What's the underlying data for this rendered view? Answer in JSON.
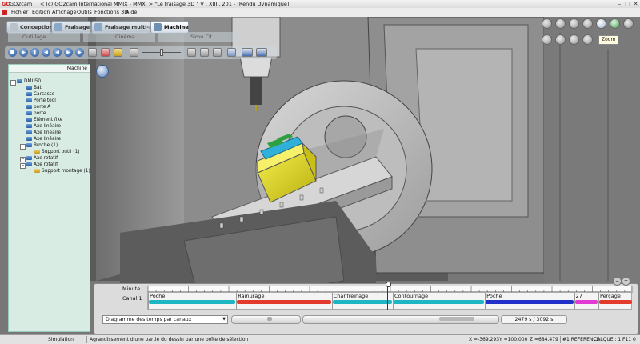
{
  "titlebar": {
    "app": "GO2cam",
    "title": "< (c) GO2cam International MMIX - MMXI >  \"Le fraisage 3D \"  V . XIII . 201 - [Rendu Dynamique]",
    "controls": [
      "–",
      "□",
      "✕"
    ]
  },
  "menu": [
    "Fichier",
    "Edition",
    "Affichage",
    "Outils",
    "Fonctions 3D",
    "Aide"
  ],
  "mode_tabs": [
    {
      "label": "Conception",
      "active": false
    },
    {
      "label": "Fraisage",
      "active": false
    },
    {
      "label": "Fraisage multi-axes",
      "active": false
    },
    {
      "label": "Machine",
      "active": true
    }
  ],
  "sub_tabs": [
    "Outillage",
    "Cinéma",
    "Simu Cit"
  ],
  "tree": {
    "header": "Machine",
    "items": [
      {
        "label": "DMU50",
        "level": 0,
        "expander": "−"
      },
      {
        "label": "Bâti",
        "level": 1
      },
      {
        "label": "Carcasse",
        "level": 1
      },
      {
        "label": "Porte tool",
        "level": 1
      },
      {
        "label": "porte A",
        "level": 1
      },
      {
        "label": "porte",
        "level": 1
      },
      {
        "label": "Elément fixe",
        "level": 1
      },
      {
        "label": "Axe linéaire",
        "level": 1
      },
      {
        "label": "Axe linéaire",
        "level": 1
      },
      {
        "label": "Axe linéaire",
        "level": 1
      },
      {
        "label": "Broche (1)",
        "level": 1,
        "expander": "−"
      },
      {
        "label": "Support outil (1)",
        "level": 2,
        "yellow": true
      },
      {
        "label": "Axe rotatif",
        "level": 1,
        "expander": "−"
      },
      {
        "label": "Axe rotatif",
        "level": 1,
        "expander": "−"
      },
      {
        "label": "Support montage (1)",
        "level": 2,
        "yellow": true
      }
    ]
  },
  "zoom_tooltip": "Zoom",
  "timeline": {
    "row_minute": "Minute",
    "row_channel": "Canal 1",
    "operations": [
      {
        "label": "Poche",
        "color": "#1fb6c4",
        "start": 0.0,
        "end": 0.182
      },
      {
        "label": "Rainurage",
        "color": "#e33a2e",
        "start": 0.182,
        "end": 0.379
      },
      {
        "label": "Chanfreinage",
        "color": "#1fb6c4",
        "start": 0.379,
        "end": 0.505
      },
      {
        "label": "Contournage",
        "color": "#1fb6c4",
        "start": 0.505,
        "end": 0.695
      },
      {
        "label": "Poche",
        "color": "#2130c8",
        "start": 0.695,
        "end": 0.879
      },
      {
        "label": "27",
        "color": "#e23ad2",
        "start": 0.879,
        "end": 0.929
      },
      {
        "label": "Perçage",
        "color": "#e33a2e",
        "start": 0.929,
        "end": 1.0
      }
    ],
    "dropdown": "Diagramme des temps par canaux",
    "time_readout": "2479 s  /  3092 s",
    "progress": 0.8017
  },
  "status": {
    "mode": "Simulation",
    "message": "Agrandissement d'une partie du dessin par une boîte de sélection",
    "x": "X =-369.293",
    "y": "Y =100.000",
    "z": "Z =684.479",
    "ref": "#1 REFERENCE",
    "layer": "CALQUE : 1",
    "f": "F11 0"
  },
  "colors": {
    "workpiece": "#e6de1e",
    "fixture_cyan": "#2fb0d8",
    "fixture_green": "#2fa040",
    "accent_blue": "#1f4f9a"
  }
}
